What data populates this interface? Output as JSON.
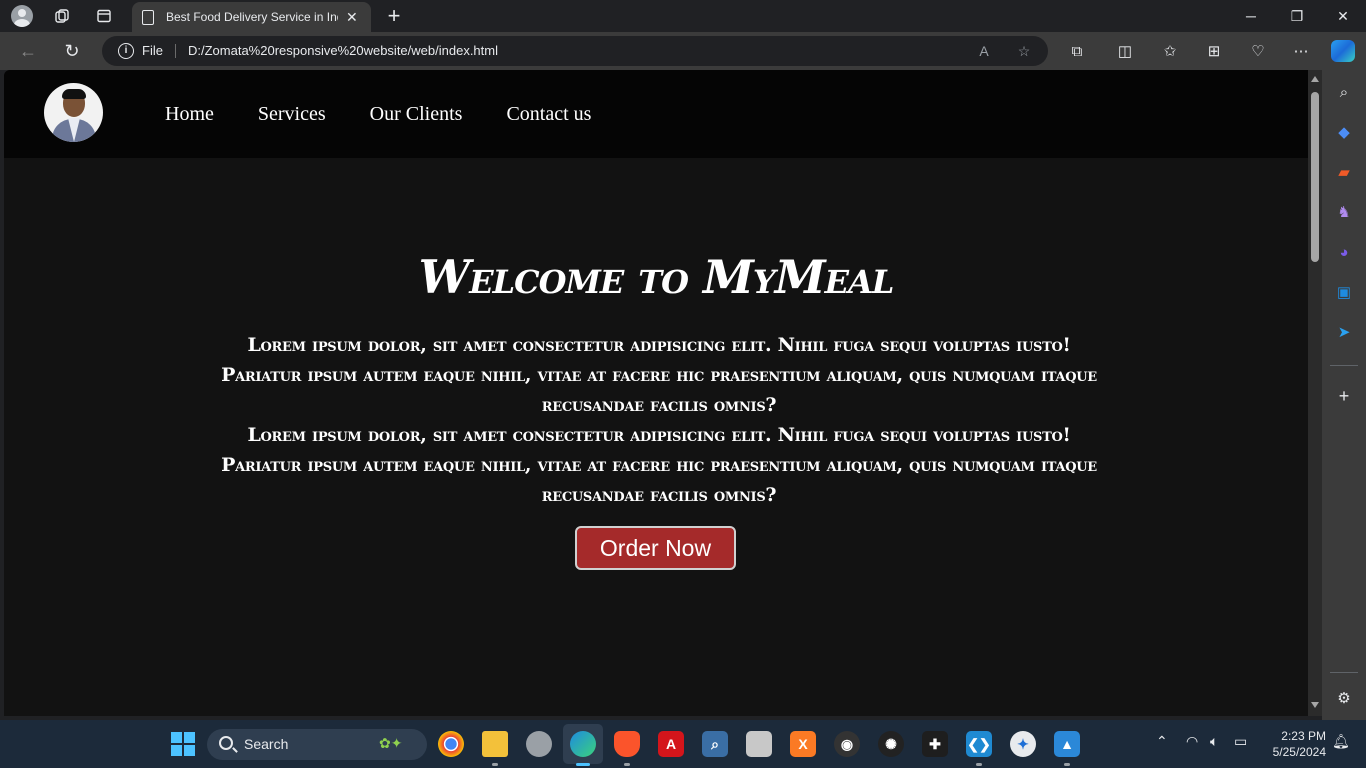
{
  "browser": {
    "tab_title": "Best Food Delivery Service in Ind",
    "address_scheme": "File",
    "address_url": "D:/Zomata%20responsive%20website/web/index.html"
  },
  "site": {
    "nav": [
      "Home",
      "Services",
      "Our Clients",
      "Contact us"
    ],
    "hero_title": "Welcome to MyMeal",
    "hero_paragraph_1": "Lorem ipsum dolor, sit amet consectetur adipisicing elit. Nihil fuga sequi voluptas iusto! Pariatur ipsum autem eaque nihil, vitae at facere hic praesentium aliquam, quis numquam itaque recusandae facilis omnis?",
    "hero_paragraph_2": "Lorem ipsum dolor, sit amet consectetur adipisicing elit. Nihil fuga sequi voluptas iusto! Pariatur ipsum autem eaque nihil, vitae at facere hic praesentium aliquam, quis numquam itaque recusandae facilis omnis?",
    "order_button": "Order Now",
    "button_color": "#a52a2a"
  },
  "taskbar": {
    "search_label": "Search",
    "time": "2:23 PM",
    "date": "5/25/2024"
  }
}
